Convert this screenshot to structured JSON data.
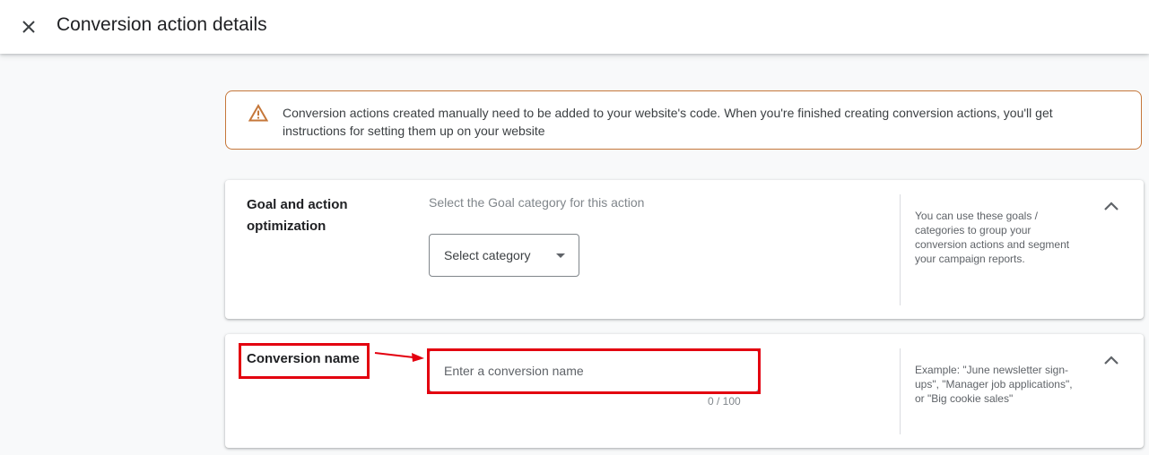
{
  "header": {
    "title": "Conversion action details",
    "close_icon": "close-icon"
  },
  "notice": {
    "icon": "warning-icon",
    "text": "Conversion actions created manually need to be added to your website's code. When you're finished creating conversion actions, you'll get instructions for setting them up on your website",
    "border_color": "#c5773a"
  },
  "goal_section": {
    "label": "Goal and action optimization",
    "hint": "Select the Goal category for this action",
    "select_value": "Select category",
    "help": "You can use these goals / categories to group your conversion actions and segment your campaign reports.",
    "collapse_icon": "chevron-up-icon"
  },
  "name_section": {
    "label": "Conversion name",
    "placeholder": "Enter a conversion name",
    "counter": "0 / 100",
    "help": "Example: \"June newsletter sign-ups\", \"Manager job applications\", or \"Big cookie sales\"",
    "collapse_icon": "chevron-up-icon"
  },
  "annotations": {
    "highlight_color": "#e3000f"
  }
}
